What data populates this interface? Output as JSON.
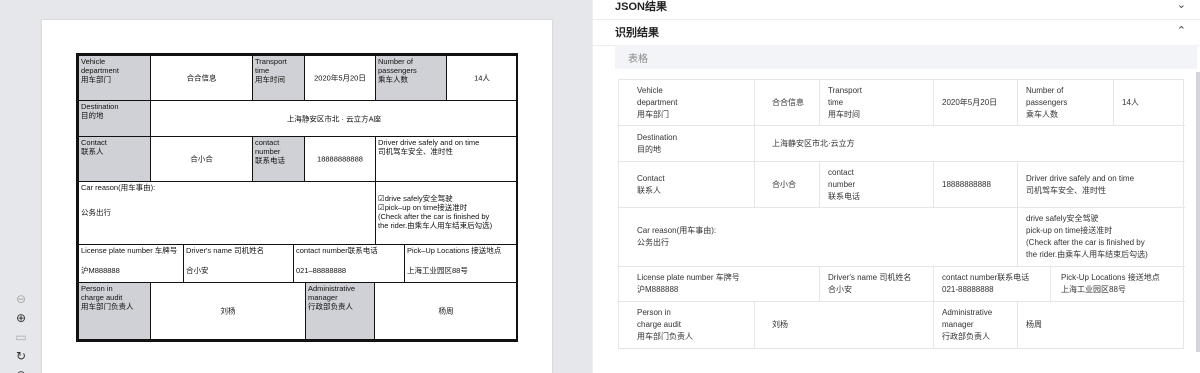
{
  "viewer": {
    "table": {
      "vehicle_dept_label": "Vehicle\ndepartment\n用车部门",
      "vehicle_dept_value": "合合信息",
      "transport_time_label": "Transport\ntime\n用车时间",
      "transport_time_value": "2020年5月20日",
      "passengers_label": "Number of\npassengers\n乘车人数",
      "passengers_value": "14人",
      "destination_label": "Destination\n目的地",
      "destination_value": "上海静安区市北 · 云立方A座",
      "contact_label": "Contact\n联系人",
      "contact_value": "合小合",
      "contact_number_label": "contact\nnumber\n联系电话",
      "contact_number_value": "18888888888",
      "drive_safe_note": "Driver drive safely and on time\n司机驾车安全、准时性",
      "car_reason_label": "Car reason(用车事由):",
      "car_reason_value": "公务出行",
      "checklist": "☑drive safely安全驾驶\n☑pick–up on time接送准时\n(Check after the car is finished by\nthe rider.由乘车人用车结束后勾选)",
      "plate_label": "License plate number 车牌号",
      "plate_value": "沪M888888",
      "driver_name_label": "Driver's name 司机姓名",
      "driver_name_value": "合小安",
      "driver_contact_label": "contact number联系电话",
      "driver_contact_value": "021–88888888",
      "pickup_label": "Pick–Up Locations 接送地点",
      "pickup_value": "上海工业园区88号",
      "audit_label": "Person in\ncharge audit\n用车部门负责人",
      "audit_value": "刘杨",
      "admin_label": "Administrative\nmanager\n行政部负责人",
      "admin_value": "杨周"
    },
    "zoom_icons": [
      "zoom-out-icon",
      "zoom-in-icon",
      "fit-page-icon",
      "rotate-icon",
      "reset-icon"
    ]
  },
  "panel": {
    "json_section_title": "JSON结果",
    "recognition_section_title": "识别结果",
    "tab_label": "表格",
    "table": {
      "vehicle_dept_label": "Vehicle\ndepartment\n用车部门",
      "vehicle_dept_value": "合合信息",
      "transport_time_label": "Transport\ntime\n用车时间",
      "transport_time_value": "2020年5月20日",
      "passengers_label": "Number of\npassengers\n乘车人数",
      "passengers_value": "14人",
      "destination_label": "Destination\n目的地",
      "destination_value": "上海静安区市北·云立方",
      "contact_label": "Contact\n联系人",
      "contact_value": "合小合",
      "contact_number_label": "contact\nnumber\n联系电话",
      "contact_number_value": "18888888888",
      "drive_safe_note": "Driver drive safely and on time\n司机驾车安全、准时性",
      "car_reason": "Car reason(用车事由):\n公务出行",
      "checklist": "drive safely安全驾驶\npick-up on time接送准时\n(Check after the car is finished by\nthe rider.由乘车人用车结束后勾选)",
      "plate": "License plate number 车牌号\n沪M888888",
      "driver_name": "Driver's name 司机姓名\n合小安",
      "driver_contact": "contact number联系电话\n021-88888888",
      "pickup": "Pick-Up Locations 接送地点\n上海工业园区88号",
      "audit_label": "Person in\ncharge audit\n用车部门负责人",
      "audit_value": "刘杨",
      "admin_label": "Administrative\nmanager\n行政部负责人",
      "admin_value": "杨周"
    }
  }
}
